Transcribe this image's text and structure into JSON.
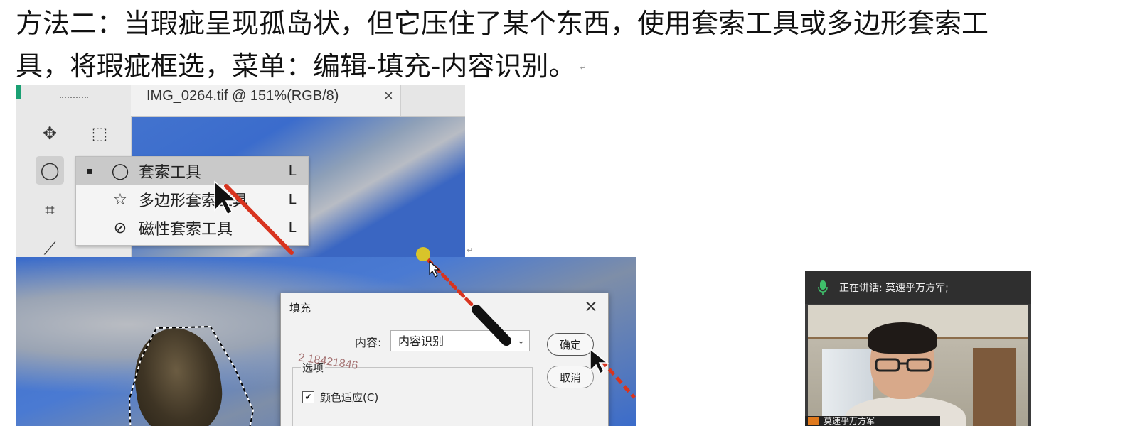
{
  "instruction": {
    "line1": "方法二：当瑕疵呈现孤岛状，但它压住了某个东西，使用套索工具或多边形套索工",
    "line2": "具，将瑕疵框选，菜单：编辑-填充-内容识别。"
  },
  "photoshop": {
    "tab_title": "IMG_0264.tif @ 151%(RGB/8)",
    "tab_close": "×",
    "tools": [
      {
        "name": "move-tool",
        "icon": "move-icon",
        "glyph": "✥"
      },
      {
        "name": "marquee-tool",
        "icon": "rect-marquee-icon",
        "glyph": "⬚"
      },
      {
        "name": "lasso-tool",
        "icon": "lasso-icon",
        "glyph": "◯"
      },
      {
        "name": "crop-tool",
        "icon": "crop-icon",
        "glyph": "⌗"
      },
      {
        "name": "eyedropper-tool",
        "icon": "eyedropper-icon",
        "glyph": "⟋"
      }
    ],
    "flyout": [
      {
        "label": "套索工具",
        "key": "L",
        "selected": true,
        "icon": "lasso-icon",
        "glyph": "◯"
      },
      {
        "label": "多边形套索工具",
        "key": "L",
        "selected": false,
        "icon": "polygon-lasso-icon",
        "glyph": "☆"
      },
      {
        "label": "磁性套索工具",
        "key": "L",
        "selected": false,
        "icon": "magnetic-lasso-icon",
        "glyph": "⊘"
      }
    ],
    "bullet": "▪"
  },
  "fill_dialog": {
    "title": "填充",
    "close": "×",
    "content_label": "内容:",
    "content_value": "内容识别",
    "caret": "⌄",
    "ok_label": "确定",
    "cancel_label": "取消",
    "options_legend": "选项",
    "color_adapt_label": "颜色适应(C)",
    "color_adapt_checked": true,
    "check_glyph": "✔",
    "watermark": "2 18421846"
  },
  "video_call": {
    "speaking_text": "正在讲话: 莫速乎万方军;",
    "name_tag": "莫速乎万方军"
  },
  "colors": {
    "pointer_red": "#d8341f",
    "pointer_yellow": "#d8c42a",
    "ps_blue": "#3b6cca",
    "accent_green": "#1aa073"
  }
}
